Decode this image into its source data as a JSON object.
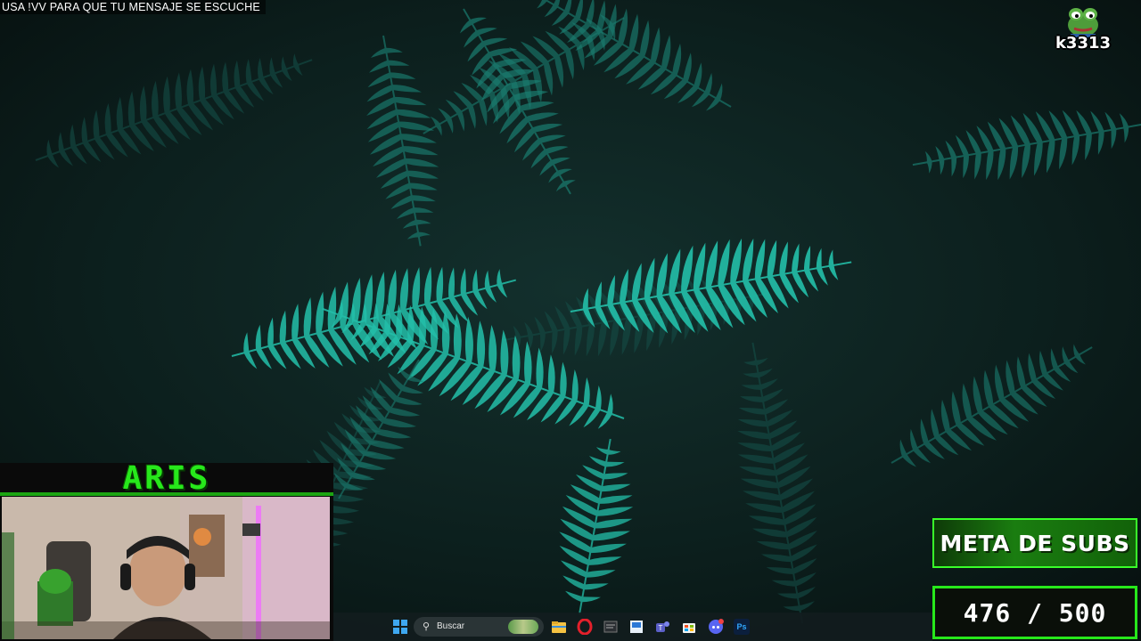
{
  "overlay": {
    "ticker_text": "USA !VV PARA QUE TU MENSAJE SE ESCUCHE",
    "streamer_name": "ARIS",
    "avatar": {
      "icon": "pepe-frog-icon",
      "name": "k3313"
    }
  },
  "subs_goal": {
    "title": "META DE SUBS",
    "current": 476,
    "target": 500,
    "display": "476 / 500"
  },
  "taskbar": {
    "search_placeholder": "Buscar",
    "apps": [
      "windows-start",
      "search",
      "file-explorer",
      "opera",
      "notes",
      "store-window",
      "teams",
      "microsoft-store",
      "discord",
      "photoshop"
    ],
    "ps_label": "Ps"
  },
  "colors": {
    "accent_green": "#27e81b",
    "fern": "#1fb8a3",
    "background": "#0b1716"
  }
}
